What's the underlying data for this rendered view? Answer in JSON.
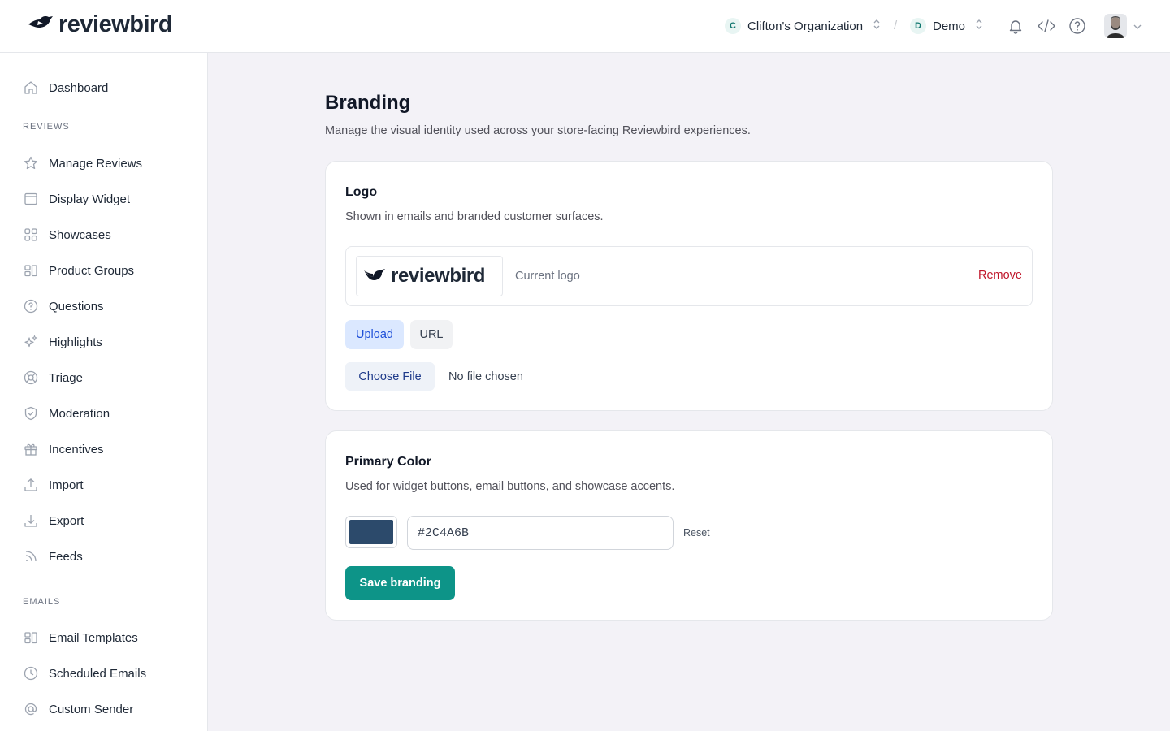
{
  "header": {
    "brand": "reviewbird",
    "org": {
      "initial": "C",
      "name": "Clifton's Organization"
    },
    "separator": "/",
    "project": {
      "initial": "D",
      "name": "Demo"
    },
    "icons": [
      "bell-icon",
      "code-icon",
      "help-icon"
    ]
  },
  "sidebar": {
    "top": [
      {
        "label": "Dashboard",
        "icon": "home-icon"
      }
    ],
    "sections": [
      {
        "title": "REVIEWS",
        "items": [
          {
            "label": "Manage Reviews",
            "icon": "star-icon"
          },
          {
            "label": "Display Widget",
            "icon": "window-icon"
          },
          {
            "label": "Showcases",
            "icon": "grid-icon"
          },
          {
            "label": "Product Groups",
            "icon": "groups-icon"
          },
          {
            "label": "Questions",
            "icon": "question-icon"
          },
          {
            "label": "Highlights",
            "icon": "sparkles-icon"
          },
          {
            "label": "Triage",
            "icon": "lifebuoy-icon"
          },
          {
            "label": "Moderation",
            "icon": "shield-icon"
          },
          {
            "label": "Incentives",
            "icon": "gift-icon"
          },
          {
            "label": "Import",
            "icon": "upload-icon"
          },
          {
            "label": "Export",
            "icon": "download-icon"
          },
          {
            "label": "Feeds",
            "icon": "rss-icon"
          }
        ]
      },
      {
        "title": "EMAILS",
        "items": [
          {
            "label": "Email Templates",
            "icon": "template-icon"
          },
          {
            "label": "Scheduled Emails",
            "icon": "clock-icon"
          },
          {
            "label": "Custom Sender",
            "icon": "at-icon"
          }
        ]
      }
    ]
  },
  "page": {
    "title": "Branding",
    "subtitle": "Manage the visual identity used across your store-facing Reviewbird experiences."
  },
  "logo_card": {
    "title": "Logo",
    "description": "Shown in emails and branded customer surfaces.",
    "thumb_text": "reviewbird",
    "current_label": "Current logo",
    "remove_label": "Remove",
    "tabs": {
      "upload": "Upload",
      "url": "URL",
      "active": "Upload"
    },
    "choose_label": "Choose File",
    "file_status": "No file chosen"
  },
  "color_card": {
    "title": "Primary Color",
    "description": "Used for widget buttons, email buttons, and showcase accents.",
    "value": "#2C4A6B",
    "reset_label": "Reset",
    "save_label": "Save branding"
  },
  "colors": {
    "accent": "#0d9488",
    "primary_swatch": "#2C4A6B",
    "danger": "#c0172b"
  }
}
